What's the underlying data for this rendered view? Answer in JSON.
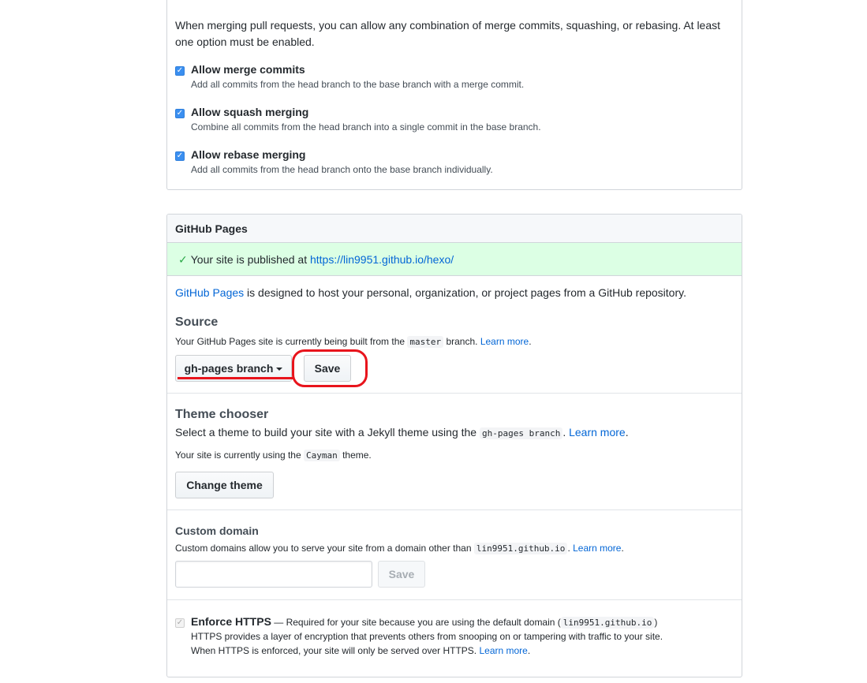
{
  "merge": {
    "intro": "When merging pull requests, you can allow any combination of merge commits, squashing, or rebasing. At least one option must be enabled.",
    "options": [
      {
        "title": "Allow merge commits",
        "desc": "Add all commits from the head branch to the base branch with a merge commit.",
        "checked": true
      },
      {
        "title": "Allow squash merging",
        "desc": "Combine all commits from the head branch into a single commit in the base branch.",
        "checked": true
      },
      {
        "title": "Allow rebase merging",
        "desc": "Add all commits from the head branch onto the base branch individually.",
        "checked": true
      }
    ]
  },
  "pages": {
    "header": "GitHub Pages",
    "flash_text": "Your site is published at ",
    "flash_url": "https://lin9951.github.io/hexo/",
    "intro_link": "GitHub Pages",
    "intro_text": " is designed to host your personal, organization, or project pages from a GitHub repository.",
    "source": {
      "title": "Source",
      "desc_prefix": "Your GitHub Pages site is currently being built from the ",
      "desc_code": "master",
      "desc_suffix": " branch. ",
      "learn_more": "Learn more",
      "learn_more_suffix": ".",
      "branch_select": "gh-pages branch",
      "save_button": "Save"
    },
    "theme": {
      "title": "Theme chooser",
      "desc_prefix": "Select a theme to build your site with a Jekyll theme using the ",
      "desc_code": "gh-pages branch",
      "desc_suffix": ". ",
      "learn_more": "Learn more",
      "learn_more_suffix": ".",
      "current_prefix": "Your site is currently using the ",
      "current_code": "Cayman",
      "current_suffix": " theme.",
      "change_button": "Change theme"
    },
    "custom_domain": {
      "title": "Custom domain",
      "desc_prefix": "Custom domains allow you to serve your site from a domain other than ",
      "desc_code": "lin9951.github.io",
      "desc_suffix": ". ",
      "learn_more": "Learn more",
      "learn_more_suffix": ".",
      "input_value": "",
      "save_button": "Save"
    },
    "https": {
      "title": "Enforce HTTPS",
      "title_suffix": " — Required for your site because you are using the default domain (",
      "code": "lin9951.github.io",
      "close": ")",
      "line2": "HTTPS provides a layer of encryption that prevents others from snooping on or tampering with traffic to your site.",
      "line3_prefix": "When HTTPS is enforced, your site will only be served over HTTPS. ",
      "learn_more": "Learn more",
      "learn_more_suffix": ".",
      "checked": true
    }
  },
  "colors": {
    "link": "#0366d6",
    "flash_bg": "#dcffe4",
    "check_green": "#28a745",
    "annotation_red": "#e8141c",
    "checkbox_blue": "#3b8ff0"
  }
}
